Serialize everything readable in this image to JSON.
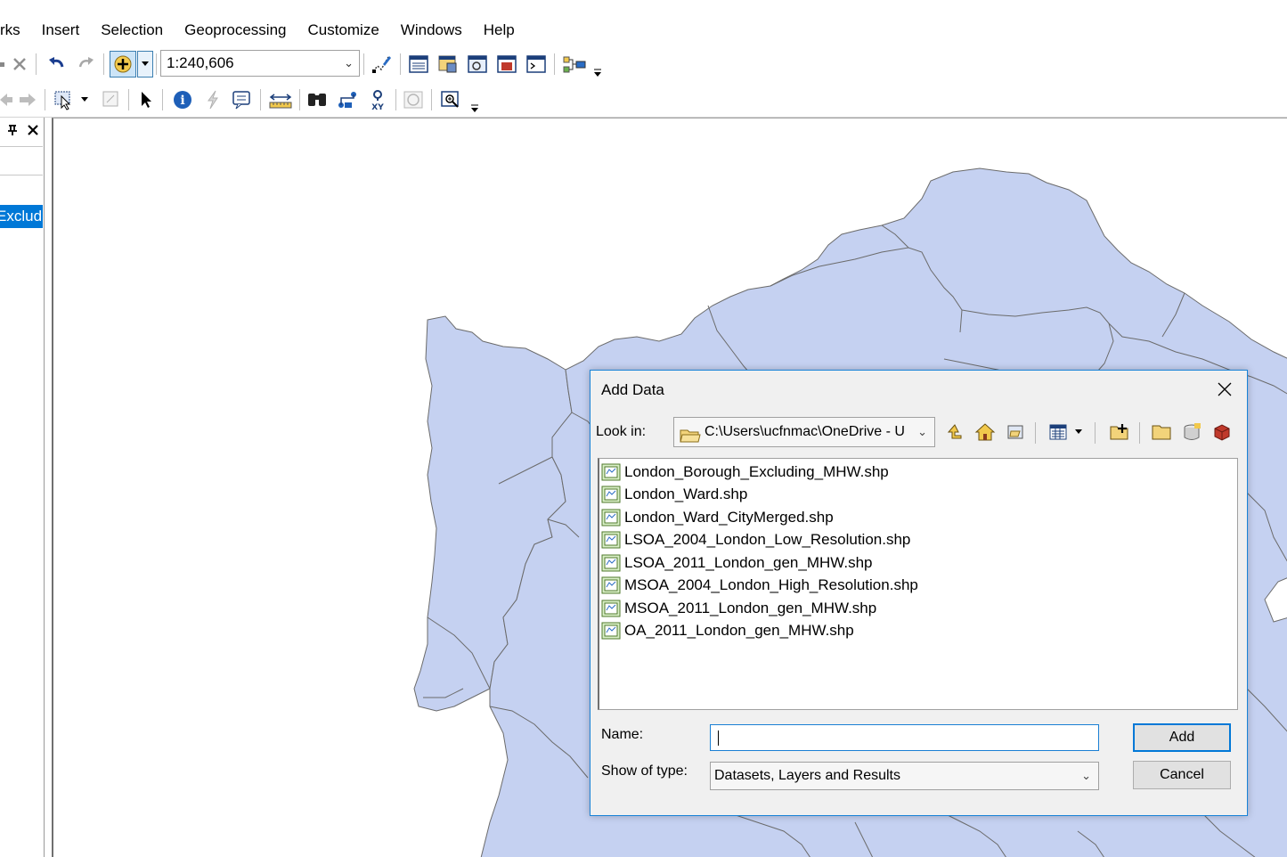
{
  "menubar": {
    "items": [
      "rks",
      "Insert",
      "Selection",
      "Geoprocessing",
      "Customize",
      "Windows",
      "Help"
    ]
  },
  "toolbar": {
    "scale_value": "1:240,606",
    "icons_row1": [
      "delete-icon",
      "undo-icon",
      "redo-icon",
      "add-data-icon",
      "add-data-dropdown-icon",
      "editor-toolbar-icon",
      "table-of-contents-icon",
      "catalog-icon",
      "search-window-icon",
      "arctoolbox-icon",
      "python-window-icon",
      "model-builder-icon"
    ],
    "icons_row2": [
      "back-extent-icon",
      "forward-extent-icon",
      "select-features-icon",
      "clear-selection-icon",
      "select-elements-icon",
      "identify-icon",
      "hyperlink-icon",
      "html-popup-icon",
      "measure-icon",
      "find-icon",
      "find-route-icon",
      "go-to-xy-icon",
      "time-slider-icon",
      "viewer-window-icon"
    ]
  },
  "toc": {
    "selected_layer": "Excludi"
  },
  "dialog": {
    "title": "Add Data",
    "look_in_label": "Look in:",
    "look_in_value": "C:\\Users\\ucfnmac\\OneDrive - U",
    "files": [
      "London_Borough_Excluding_MHW.shp",
      "London_Ward.shp",
      "London_Ward_CityMerged.shp",
      "LSOA_2004_London_Low_Resolution.shp",
      "LSOA_2011_London_gen_MHW.shp",
      "MSOA_2004_London_High_Resolution.shp",
      "MSOA_2011_London_gen_MHW.shp",
      "OA_2011_London_gen_MHW.shp"
    ],
    "name_label": "Name:",
    "name_value": "",
    "type_label": "Show of type:",
    "type_value": "Datasets, Layers and Results",
    "add_button": "Add",
    "cancel_button": "Cancel"
  },
  "colors": {
    "map_fill": "#c5d1f1",
    "map_stroke": "#6b6b6b",
    "selection": "#0078d7",
    "dialog_border": "#1883d7"
  }
}
